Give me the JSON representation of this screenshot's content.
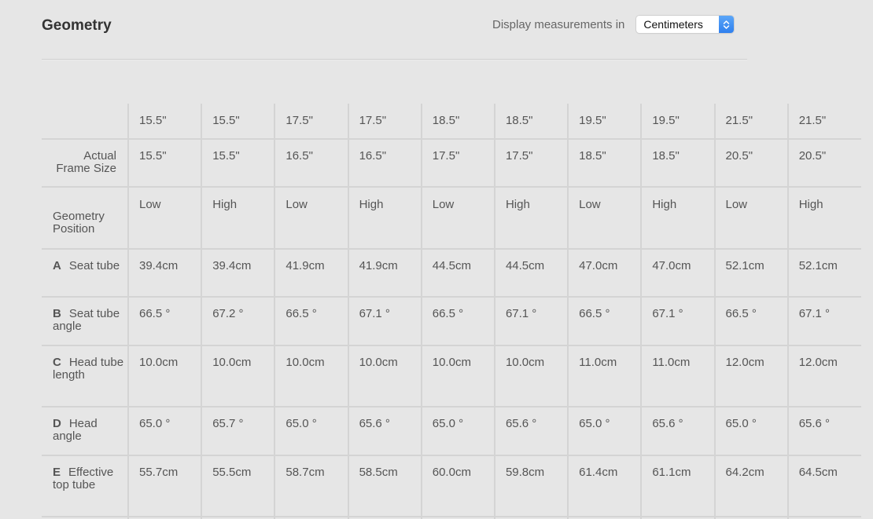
{
  "header": {
    "title": "Geometry",
    "units_label": "Display measurements in",
    "units_selected": "Centimeters",
    "accent_color": "#2f80ee"
  },
  "table": {
    "sizes": [
      "15.5\"",
      "15.5\"",
      "17.5\"",
      "17.5\"",
      "18.5\"",
      "18.5\"",
      "19.5\"",
      "19.5\"",
      "21.5\"",
      "21.5\""
    ],
    "rows": [
      {
        "letter": "",
        "label": "Actual Frame Size",
        "values": [
          "15.5\"",
          "15.5\"",
          "16.5\"",
          "16.5\"",
          "17.5\"",
          "17.5\"",
          "18.5\"",
          "18.5\"",
          "20.5\"",
          "20.5\""
        ]
      },
      {
        "letter": "",
        "label": "Geometry Position",
        "values": [
          "Low",
          "High",
          "Low",
          "High",
          "Low",
          "High",
          "Low",
          "High",
          "Low",
          "High"
        ]
      },
      {
        "letter": "A",
        "label": "Seat tube",
        "values": [
          "39.4cm",
          "39.4cm",
          "41.9cm",
          "41.9cm",
          "44.5cm",
          "44.5cm",
          "47.0cm",
          "47.0cm",
          "52.1cm",
          "52.1cm"
        ]
      },
      {
        "letter": "B",
        "label": "Seat tube angle",
        "values": [
          "66.5 °",
          "67.2 °",
          "66.5 °",
          "67.1 °",
          "66.5 °",
          "67.1 °",
          "66.5 °",
          "67.1 °",
          "66.5 °",
          "67.1 °"
        ]
      },
      {
        "letter": "C",
        "label": "Head tube length",
        "values": [
          "10.0cm",
          "10.0cm",
          "10.0cm",
          "10.0cm",
          "10.0cm",
          "10.0cm",
          "11.0cm",
          "11.0cm",
          "12.0cm",
          "12.0cm"
        ]
      },
      {
        "letter": "D",
        "label": "Head angle",
        "values": [
          "65.0 °",
          "65.7 °",
          "65.0 °",
          "65.6 °",
          "65.0 °",
          "65.6 °",
          "65.0 °",
          "65.6 °",
          "65.0 °",
          "65.6 °"
        ]
      },
      {
        "letter": "E",
        "label": "Effective top tube",
        "values": [
          "55.7cm",
          "55.5cm",
          "58.7cm",
          "58.5cm",
          "60.0cm",
          "59.8cm",
          "61.4cm",
          "61.1cm",
          "64.2cm",
          "64.5cm"
        ]
      }
    ]
  }
}
